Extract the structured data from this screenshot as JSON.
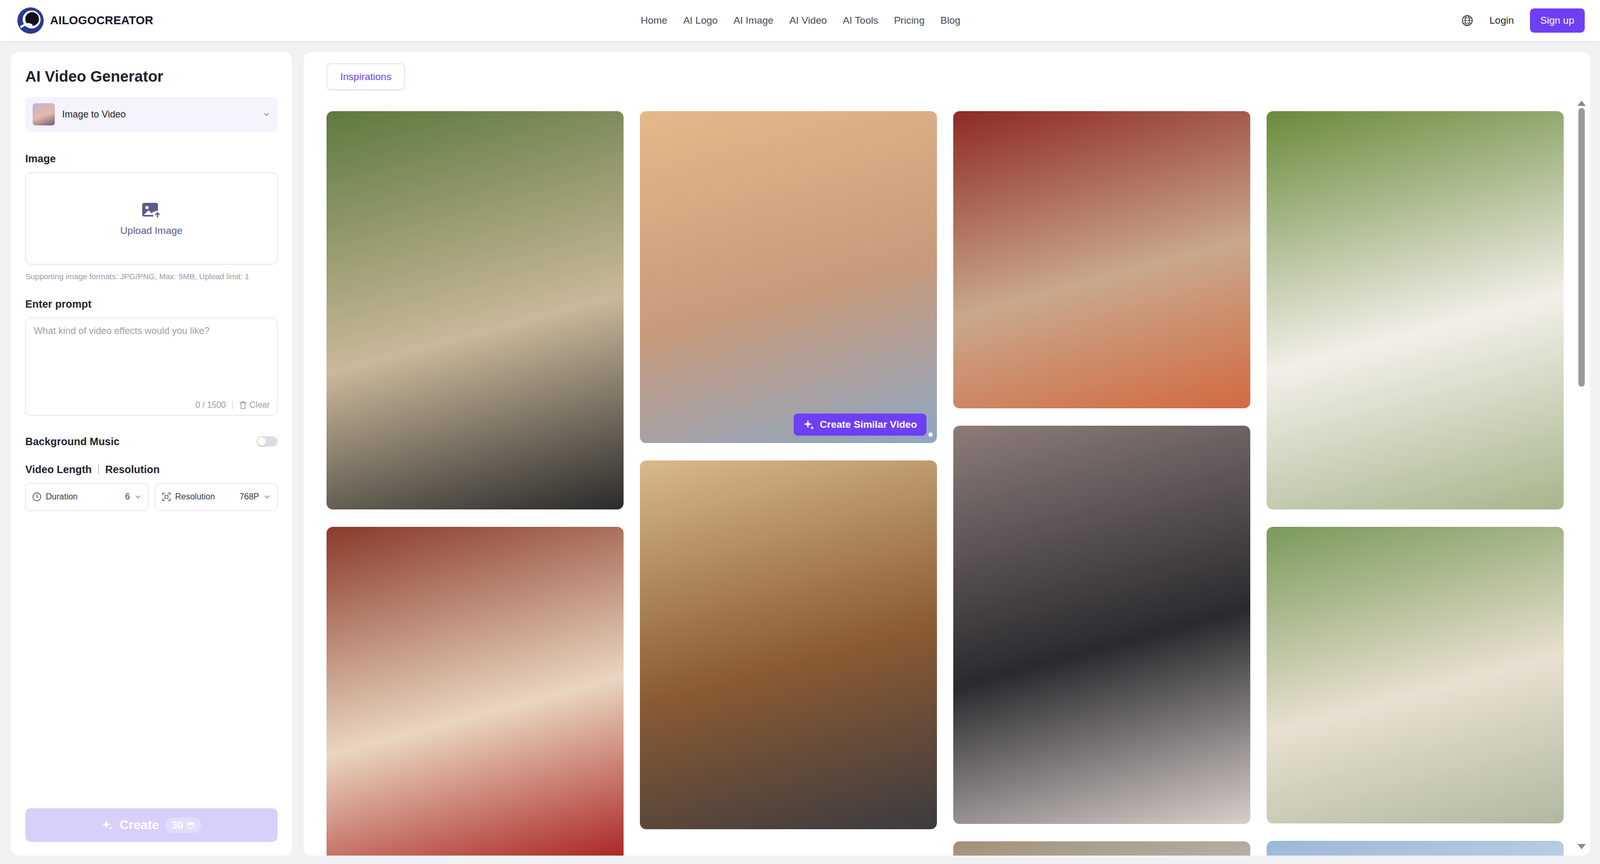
{
  "header": {
    "logo": "AILOGOCREATOR",
    "nav": [
      "Home",
      "AI Logo",
      "AI Image",
      "AI Video",
      "AI Tools",
      "Pricing",
      "Blog"
    ],
    "login": "Login",
    "signup": "Sign up"
  },
  "generator": {
    "title": "AI Video Generator",
    "mode": "Image to Video",
    "image_label": "Image",
    "upload_label": "Upload Image",
    "upload_hint": "Supporting image formats: JPG/PNG, Max: 5MB, Upload limit: 1",
    "prompt_label": "Enter prompt",
    "prompt_placeholder": "What kind of video effects would you like?",
    "prompt_count": "0 / 1500",
    "clear": "Clear",
    "music_label": "Background Music",
    "music_on": false,
    "length_label": "Video Length",
    "resolution_label": "Resolution",
    "duration": {
      "label": "Duration",
      "value": "6"
    },
    "resolution": {
      "label": "Resolution",
      "value": "768P"
    },
    "create": {
      "label": "Create",
      "cost": "30",
      "disabled": true
    }
  },
  "gallery": {
    "tabs": [
      {
        "label": "Inspirations",
        "selected": true
      }
    ],
    "action_label": "Create Similar Video",
    "columns": [
      [
        {
          "hovered": false
        },
        {
          "hovered": false
        }
      ],
      [
        {
          "hovered": true
        },
        {
          "hovered": false
        }
      ],
      [
        {
          "hovered": false
        },
        {
          "hovered": false
        },
        {
          "hovered": false
        }
      ],
      [
        {
          "hovered": false
        },
        {
          "hovered": false
        },
        {
          "hovered": false
        }
      ]
    ],
    "scrollbar": {
      "level": 0.38
    }
  }
}
